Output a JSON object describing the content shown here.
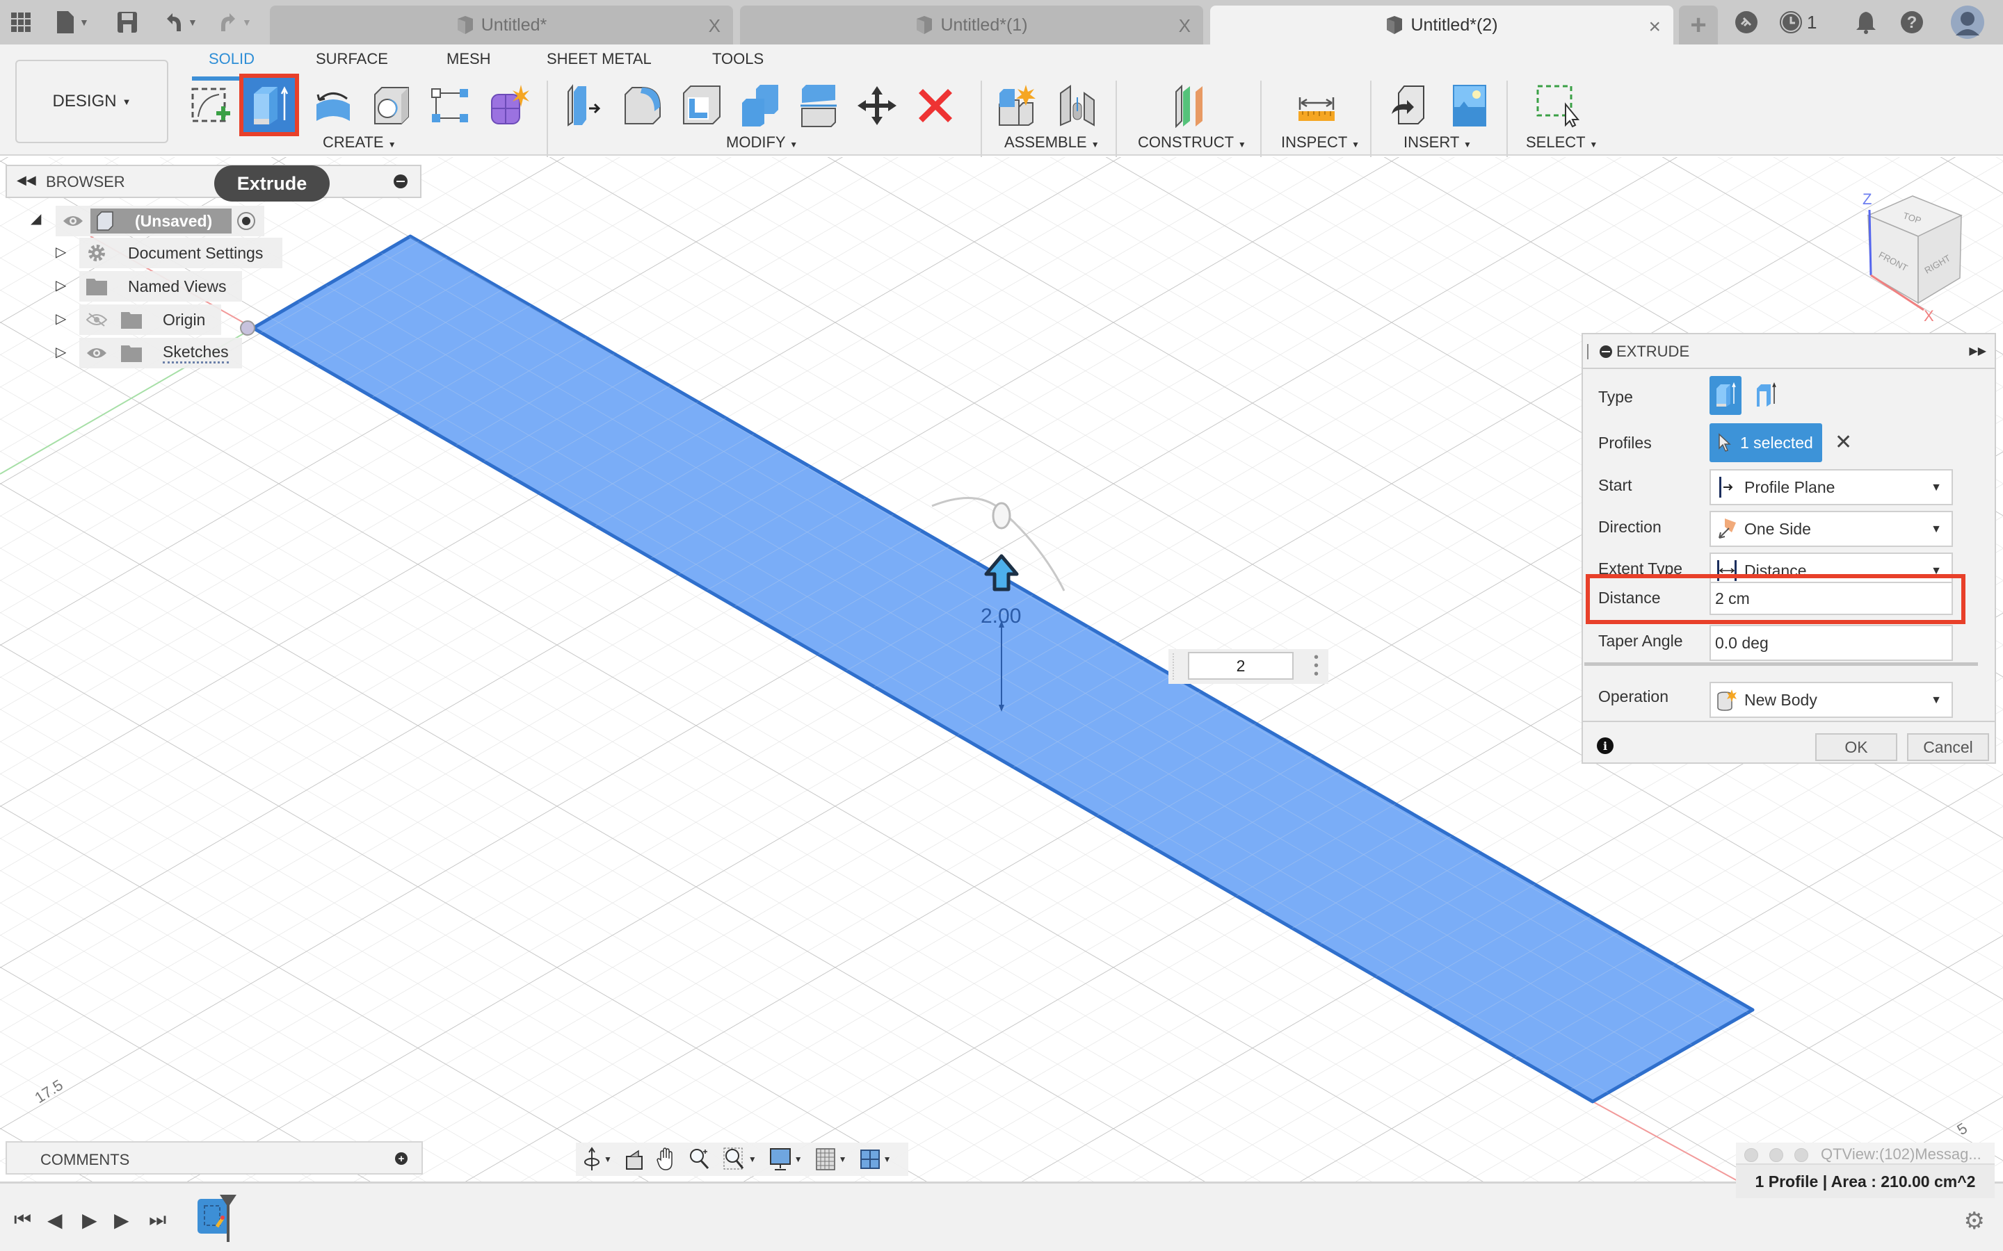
{
  "titlebar": {
    "tabs": [
      {
        "label": "Untitled*",
        "active": false
      },
      {
        "label": "Untitled*(1)",
        "active": false
      },
      {
        "label": "Untitled*(2)",
        "active": true
      }
    ],
    "tab_close": "X",
    "jobs_count": "1",
    "icons": [
      "app-grid-icon",
      "file-icon",
      "save-icon",
      "undo-icon",
      "redo-icon",
      "new-tab-icon",
      "offline-icon",
      "job-status-icon",
      "notifications-icon",
      "help-icon",
      "avatar"
    ]
  },
  "toolbar": {
    "workspace_button": "DESIGN",
    "workspace_tabs": [
      "SOLID",
      "SURFACE",
      "MESH",
      "SHEET METAL",
      "TOOLS"
    ],
    "active_workspace_tab": "SOLID",
    "groups": {
      "create": "CREATE",
      "modify": "MODIFY",
      "assemble": "ASSEMBLE",
      "construct": "CONSTRUCT",
      "inspect": "INSPECT",
      "insert": "INSERT",
      "select": "SELECT"
    },
    "highlighted_tool": "Extrude"
  },
  "tooltip": "Extrude",
  "browser": {
    "title": "BROWSER",
    "root": "(Unsaved)",
    "items": [
      {
        "label": "Document Settings",
        "icon": "gear-icon"
      },
      {
        "label": "Named Views",
        "icon": "folder-icon"
      },
      {
        "label": "Origin",
        "icon": "folder-icon",
        "visibility": "hidden"
      },
      {
        "label": "Sketches",
        "icon": "folder-icon",
        "visibility": "visible"
      }
    ]
  },
  "viewport": {
    "dimension_label": "2.00",
    "value_input": "2",
    "grid_label_left": "17.5",
    "viewcube": {
      "top": "TOP",
      "front": "FRONT",
      "right": "RIGHT",
      "axis_z": "Z",
      "axis_x": "X"
    },
    "colors": {
      "profile_fill": "#76aaf7",
      "profile_edge": "#2f6fcc"
    }
  },
  "extrude": {
    "title": "EXTRUDE",
    "fields": {
      "type_label": "Type",
      "profiles_label": "Profiles",
      "profiles_value": "1 selected",
      "start_label": "Start",
      "start_value": "Profile Plane",
      "direction_label": "Direction",
      "direction_value": "One Side",
      "extent_label": "Extent Type",
      "extent_value": "Distance",
      "distance_label": "Distance",
      "distance_value": "2 cm",
      "taper_label": "Taper Angle",
      "taper_value": "0.0 deg",
      "operation_label": "Operation",
      "operation_value": "New Body"
    },
    "ok": "OK",
    "cancel": "Cancel",
    "highlight_color": "#e8402a"
  },
  "comments": {
    "title": "COMMENTS"
  },
  "status": {
    "window_title": "QTView:(102)Messag...",
    "message": "1 Profile | Area : 210.00 cm^2"
  }
}
